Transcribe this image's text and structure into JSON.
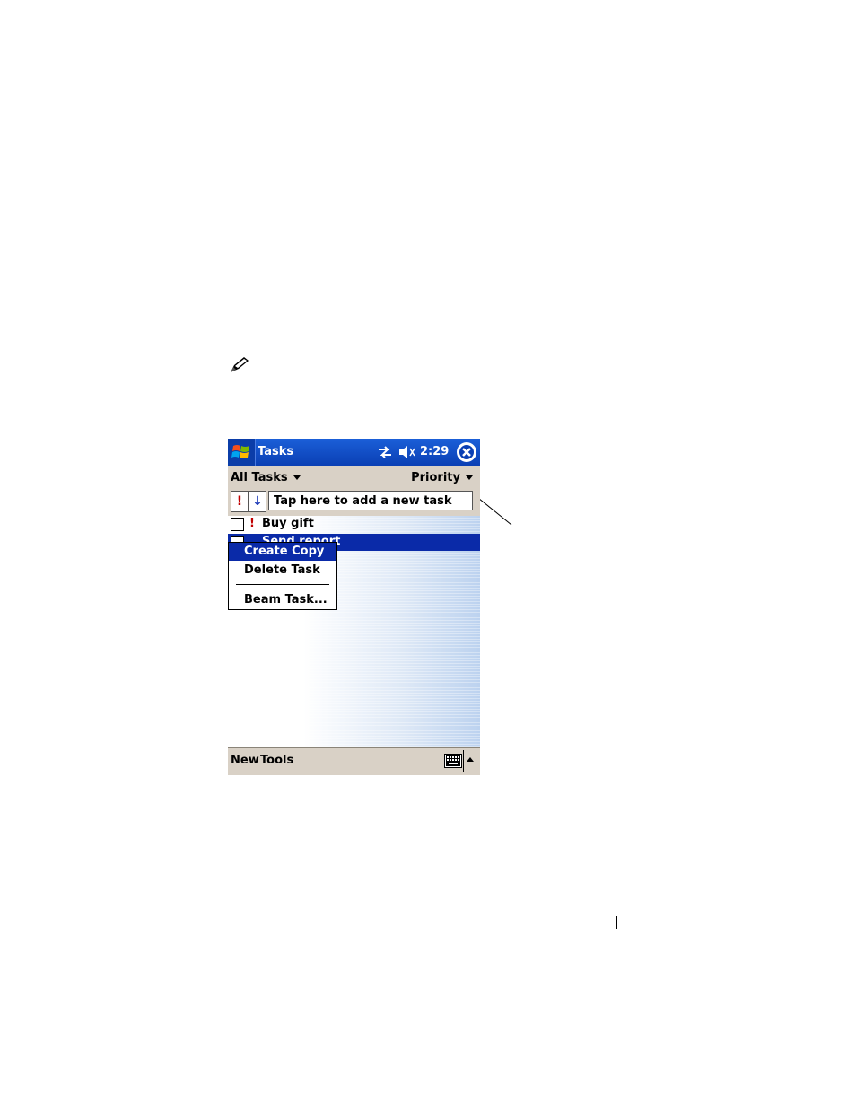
{
  "titlebar": {
    "app_title": "Tasks",
    "clock": "2:29"
  },
  "filterbar": {
    "category_filter": "All Tasks",
    "sort_by": "Priority",
    "priority_button": "!",
    "low_priority_button": "↓",
    "new_task_placeholder": "Tap here to add a new task"
  },
  "tasks": [
    {
      "label": "Buy gift",
      "priority_marker": "!",
      "checked": false,
      "selected": false
    },
    {
      "label": "Send report",
      "priority_marker": "",
      "checked": false,
      "selected": true
    }
  ],
  "context_menu": {
    "items": [
      "Create Copy",
      "Delete Task",
      "Beam Task..."
    ],
    "highlighted": "Create Copy"
  },
  "command_bar": {
    "menu_new": "New",
    "menu_tools": "Tools"
  },
  "icons": {
    "start": "windows-flag-icon",
    "sync": "sync-arrows-icon",
    "volume": "speaker-muted-icon",
    "close": "close-icon",
    "note": "pencil-note-icon",
    "keyboard": "keyboard-icon"
  },
  "colors": {
    "titlebar": "#0a3fb4",
    "selection": "#0a2aa8",
    "toolbar": "#d9d1c6",
    "priority_red": "#c00000"
  }
}
